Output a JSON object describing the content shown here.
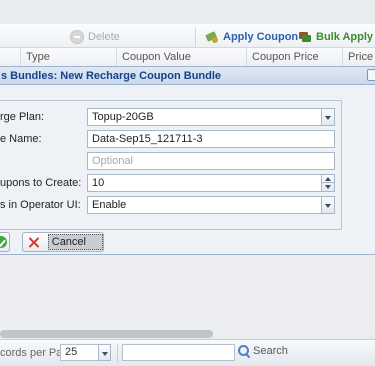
{
  "toolbar": {
    "delete_label": "Delete",
    "apply_coupon_label": "Apply Coupon",
    "bulk_apply_label": "Bulk Apply Co"
  },
  "grid": {
    "columns": [
      "Type",
      "Coupon Value",
      "Coupon Price",
      "Price T"
    ]
  },
  "dialog": {
    "title": "s Bundles: New Recharge Coupon Bundle",
    "fields": {
      "recharge_plan": {
        "label": "rge Plan:",
        "value": "Topup-20GB"
      },
      "bundle_name": {
        "label": "e Name:",
        "value": "Data-Sep15_121711-3"
      },
      "description": {
        "label": "",
        "placeholder": "Optional"
      },
      "coupons_to_create": {
        "label": "upons to Create:",
        "value": "10"
      },
      "operator_ui": {
        "label": "s in Operator UI:",
        "value": "Enable"
      }
    },
    "buttons": {
      "cancel_label": "Cancel"
    }
  },
  "pager": {
    "records_per_page_label": "cords per Page",
    "records_per_page_value": "25",
    "search_label": "Search"
  },
  "colors": {
    "title_text": "#15428b",
    "apply_coupon": "#2a61b0",
    "bulk_apply": "#3f8a32",
    "cancel_icon": "#dd3333",
    "ok_icon": "#3ea83e"
  }
}
